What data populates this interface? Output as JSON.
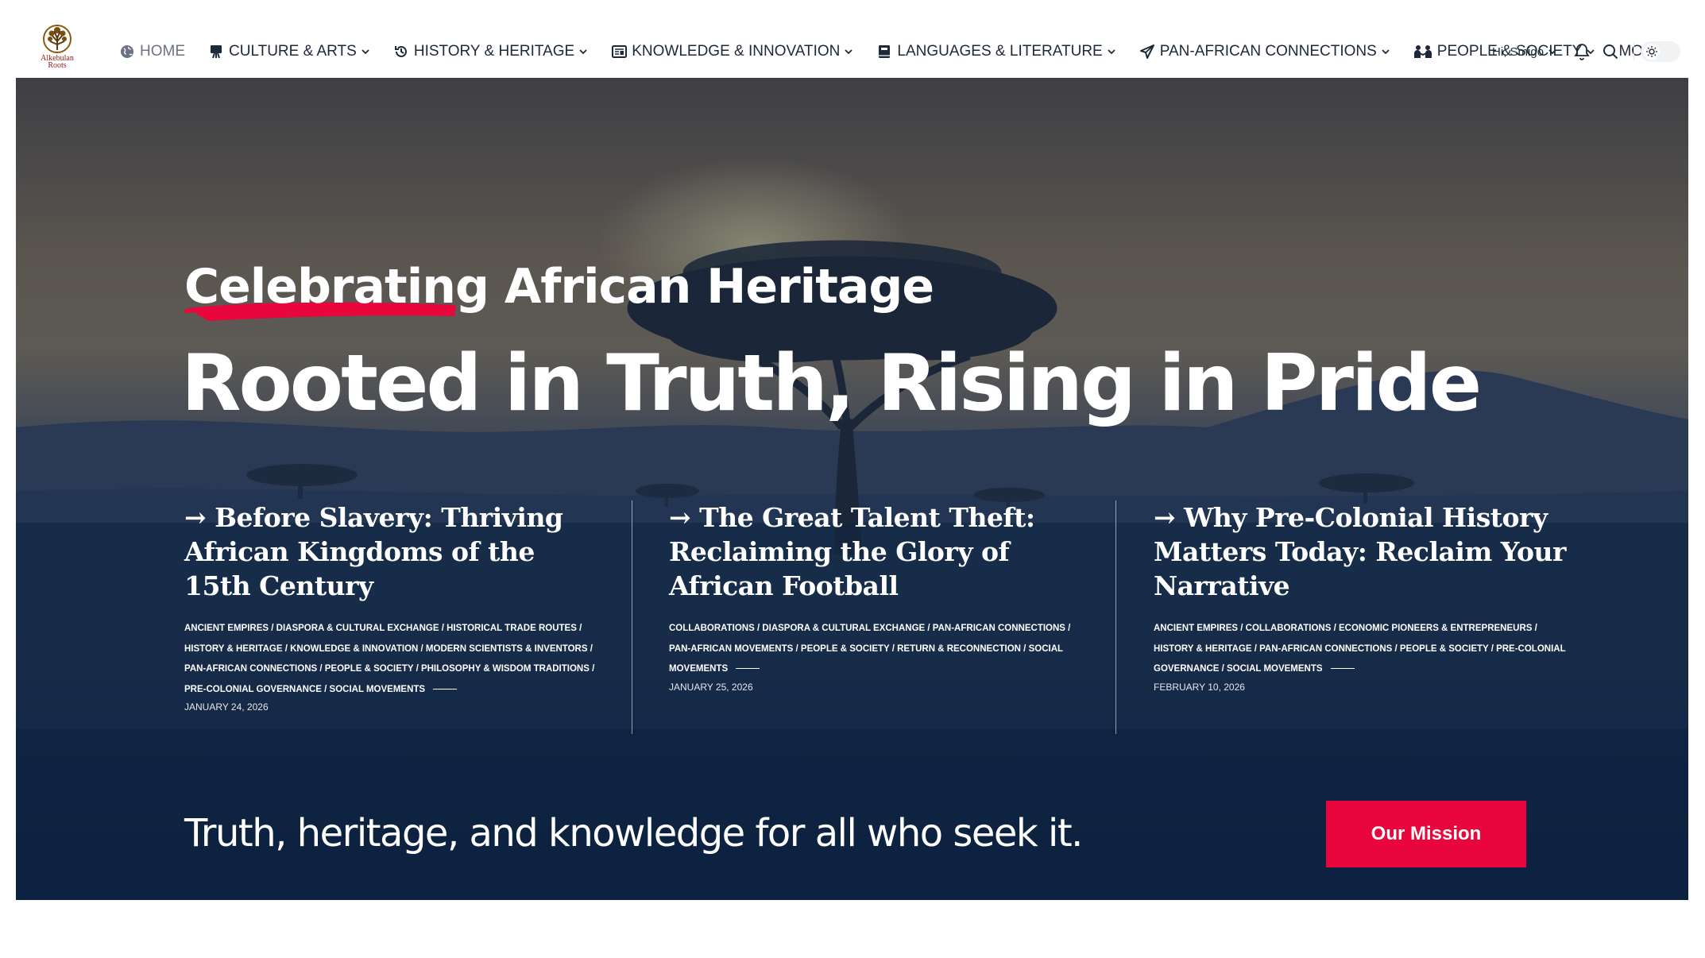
{
  "brand": {
    "logo_text_line1": "Alkebulan",
    "logo_text_line2": "Roots",
    "accent": "#e8063c",
    "logo_color": "#8a1d12"
  },
  "nav": {
    "items": [
      {
        "label": "Home",
        "icon": "globe-icon",
        "active": true
      },
      {
        "label": "Culture & Arts",
        "icon": "easel-icon"
      },
      {
        "label": "History & Heritage",
        "icon": "history-icon"
      },
      {
        "label": "Knowledge & Innovation",
        "icon": "newspaper-icon"
      },
      {
        "label": "Languages & Literature",
        "icon": "book-icon"
      },
      {
        "label": "Pan-African Connections",
        "icon": "send-icon"
      },
      {
        "label": "People & Society",
        "icon": "people-icon"
      },
      {
        "label": "More",
        "icon": ""
      }
    ],
    "user_greeting": "Hi,",
    "user_name": "Smigo",
    "icons": [
      "bell-icon",
      "search-icon",
      "sun-icon"
    ]
  },
  "hero": {
    "kicker_highlight": "Celebrating",
    "kicker_rest": " African Heritage",
    "headline": "Rooted in Truth, Rising in Pride",
    "posts": [
      {
        "title": "→ Before Slavery: Thriving African Kingdoms of the 15th Century",
        "categories": "Ancient Empires / Diaspora & Cultural Exchange / Historical Trade Routes / History & Heritage / Knowledge & Innovation / Modern Scientists & Inventors / Pan-African Connections / People & Society / Philosophy & Wisdom Traditions / Pre-Colonial Governance / Social Movements",
        "date": "January 24, 2026"
      },
      {
        "title": "→ The Great Talent Theft: Reclaiming the Glory of African Football",
        "categories": "Collaborations / Diaspora & Cultural Exchange / Pan-African Connections / Pan-African Movements / People & Society / Return & Reconnection / Social Movements",
        "date": "January 25, 2026"
      },
      {
        "title": "→ Why Pre-Colonial History Matters Today: Reclaim Your Narrative",
        "categories": "Ancient Empires / Collaborations / Economic Pioneers & Entrepreneurs / History & Heritage / Pan-African Connections / People & Society / Pre-Colonial Governance / Social Movements",
        "date": "February 10, 2026"
      }
    ],
    "tagline": "Truth, heritage, and knowledge for all who seek it.",
    "cta_label": "Our Mission"
  }
}
